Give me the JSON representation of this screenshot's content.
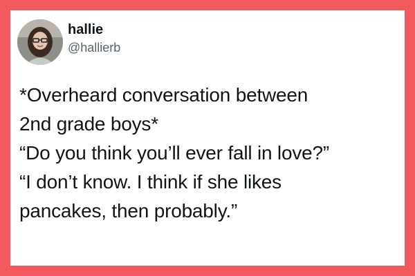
{
  "author": {
    "display_name": "hallie",
    "handle": "@hallierb",
    "avatar_icon": "profile-photo"
  },
  "tweet": {
    "lines": [
      "*Overheard conversation between",
      "2nd grade boys*",
      "“Do you think you’ll ever fall in love?”",
      "“I don’t know. I think if she likes",
      "pancakes, then probably.”"
    ]
  },
  "colors": {
    "frame": "#f25a5d",
    "card": "#ffffff",
    "text": "#0f1419",
    "handle": "#536471"
  }
}
